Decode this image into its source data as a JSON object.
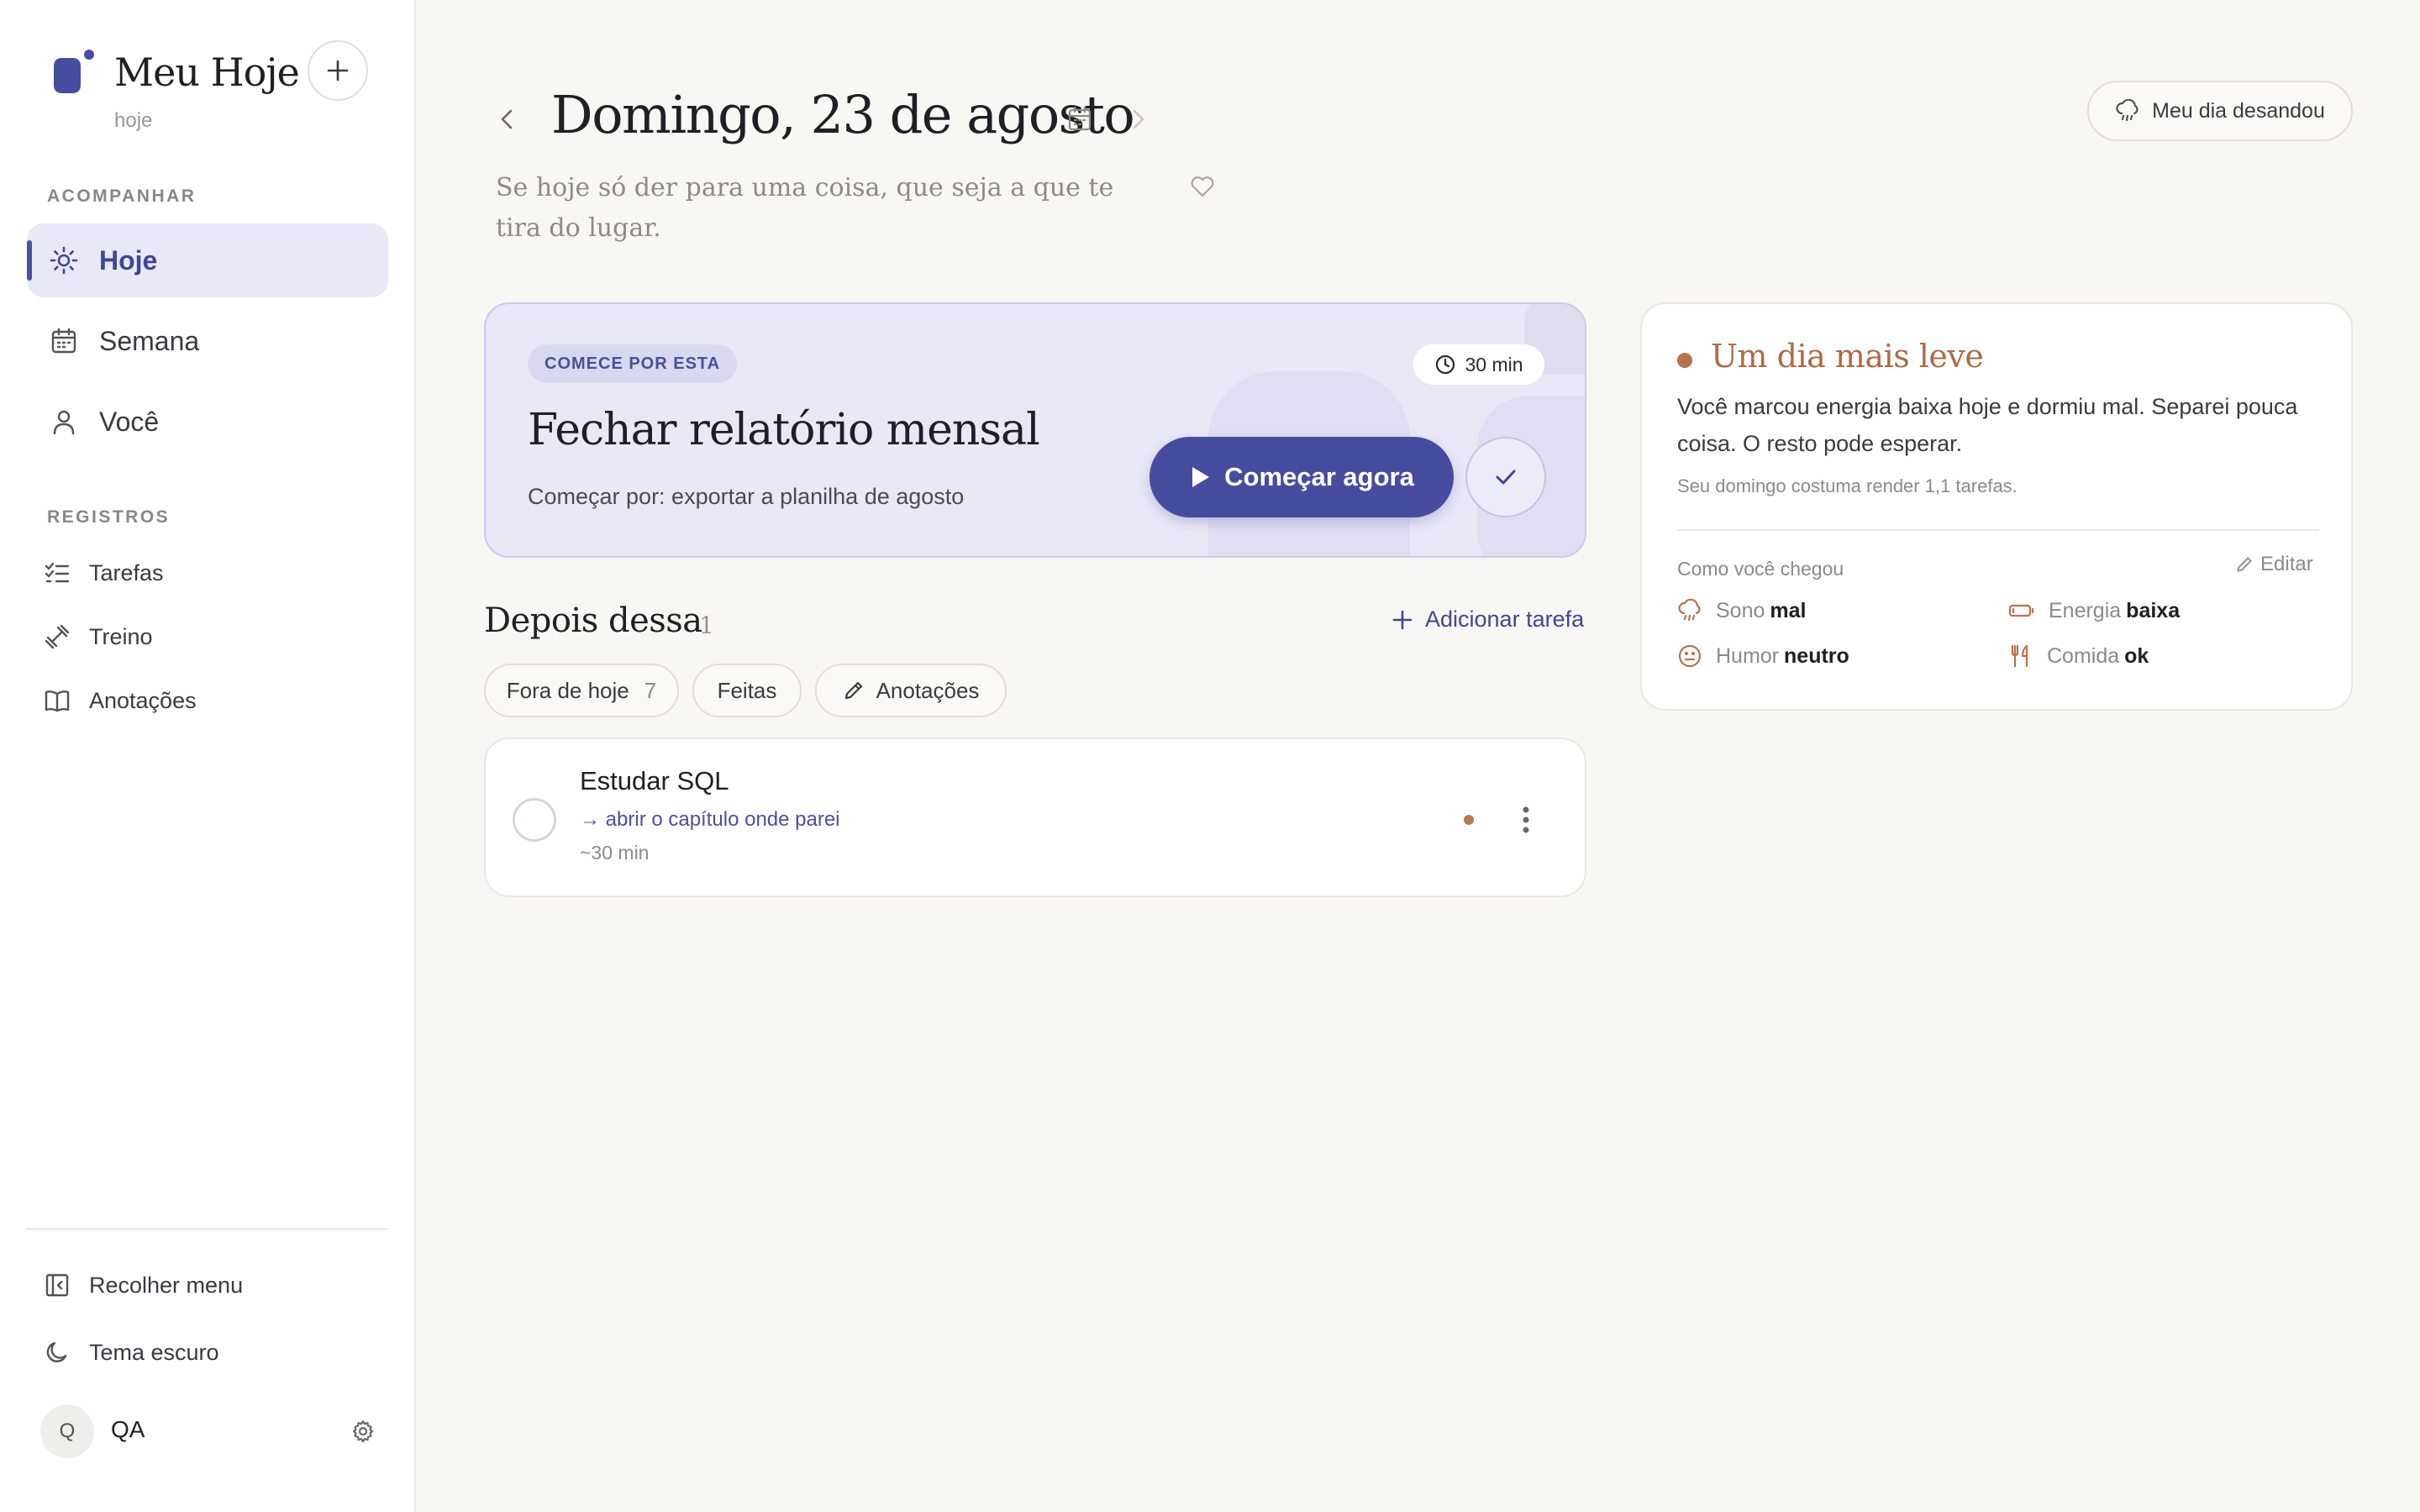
{
  "app": {
    "title": "Meu Hoje",
    "subtitle": "hoje"
  },
  "sidebar": {
    "section_track": "ACOMPANHAR",
    "nav": [
      {
        "label": "Hoje",
        "icon": "sun-icon",
        "active": true
      },
      {
        "label": "Semana",
        "icon": "calendar-icon"
      },
      {
        "label": "Você",
        "icon": "user-icon"
      }
    ],
    "section_records": "REGISTROS",
    "records": [
      {
        "label": "Tarefas",
        "icon": "checklist-icon"
      },
      {
        "label": "Treino",
        "icon": "dumbbell-icon"
      },
      {
        "label": "Anotações",
        "icon": "book-icon"
      }
    ],
    "collapse_label": "Recolher menu",
    "theme_label": "Tema escuro",
    "user": {
      "initial": "Q",
      "name": "QA"
    }
  },
  "header": {
    "date": "Domingo, 23 de agosto",
    "quote": "Se hoje só der para uma coisa, que seja a que te tira do lugar.",
    "bad_day_button": "Meu dia desandou"
  },
  "focus": {
    "badge": "COMECE POR ESTA",
    "duration": "30 min",
    "title": "Fechar relatório mensal",
    "first_step": "Começar por: exportar a planilha de agosto",
    "start_button": "Começar agora"
  },
  "after": {
    "title": "Depois dessa",
    "count": "1",
    "add_task": "Adicionar tarefa",
    "filters": [
      {
        "label": "Fora de hoje",
        "count": "7"
      },
      {
        "label": "Feitas"
      },
      {
        "label": "Anotações"
      }
    ],
    "tasks": [
      {
        "name": "Estudar SQL",
        "next_step": "→ abrir o capítulo onde parei",
        "estimate": "~30 min"
      }
    ]
  },
  "day_card": {
    "title": "Um dia mais leve",
    "text": "Você marcou energia baixa hoje e dormiu mal. Separei pouca coisa. O resto pode esperar.",
    "note": "Seu domingo costuma render 1,1 tarefas.",
    "how_label": "Como você chegou",
    "edit_label": "Editar",
    "metrics": [
      {
        "key": "Sono",
        "value": "mal",
        "icon": "cloud-rain-icon"
      },
      {
        "key": "Energia",
        "value": "baixa",
        "icon": "battery-low-icon"
      },
      {
        "key": "Humor",
        "value": "neutro",
        "icon": "face-neutral-icon"
      },
      {
        "key": "Comida",
        "value": "ok",
        "icon": "fork-knife-icon"
      }
    ]
  },
  "colors": {
    "accent": "#464d9e",
    "warm": "#b06a45",
    "background": "#f8f7f4"
  }
}
